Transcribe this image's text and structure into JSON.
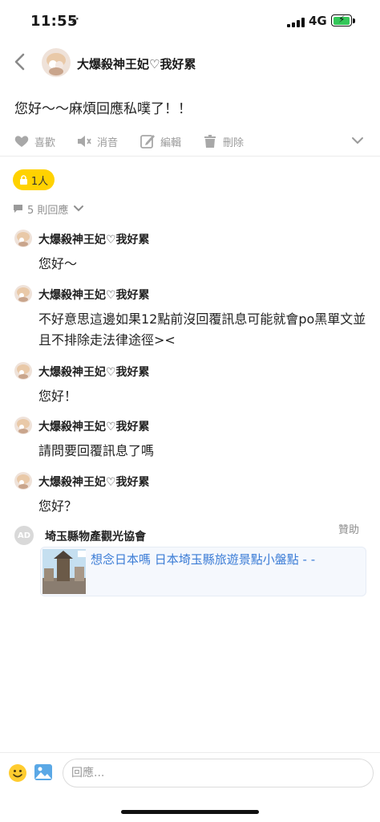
{
  "status": {
    "time": "11:55",
    "network": "4G",
    "location_glyph": "➶"
  },
  "header": {
    "title": "大爆殺神王妃♡我好累"
  },
  "post": {
    "text": "您好～～麻煩回應私噗了！！"
  },
  "actions": {
    "like": "喜歡",
    "mute": "消音",
    "edit": "編輯",
    "delete": "刪除"
  },
  "badge": {
    "label": "1人"
  },
  "replies": {
    "count_label": "5 則回應"
  },
  "comments": [
    {
      "name": "大爆殺神王妃♡我好累",
      "text": "您好～"
    },
    {
      "name": "大爆殺神王妃♡我好累",
      "text": "不好意思這邊如果12點前沒回覆訊息可能就會po黑單文並且不排除走法律途徑><"
    },
    {
      "name": "大爆殺神王妃♡我好累",
      "text": "您好！"
    },
    {
      "name": "大爆殺神王妃♡我好累",
      "text": "請問要回覆訊息了嗎"
    },
    {
      "name": "大爆殺神王妃♡我好累",
      "text": "您好？"
    }
  ],
  "ad": {
    "avatar": "AD",
    "name": "埼玉縣物產觀光協會",
    "sponsor": "贊助",
    "title": "想念日本嗎 日本埼玉縣旅遊景點小盤點 - -"
  },
  "composer": {
    "placeholder": "回應..."
  },
  "colors": {
    "badge": "#ffd200",
    "link": "#3b7cd6",
    "battery": "#34c759"
  }
}
